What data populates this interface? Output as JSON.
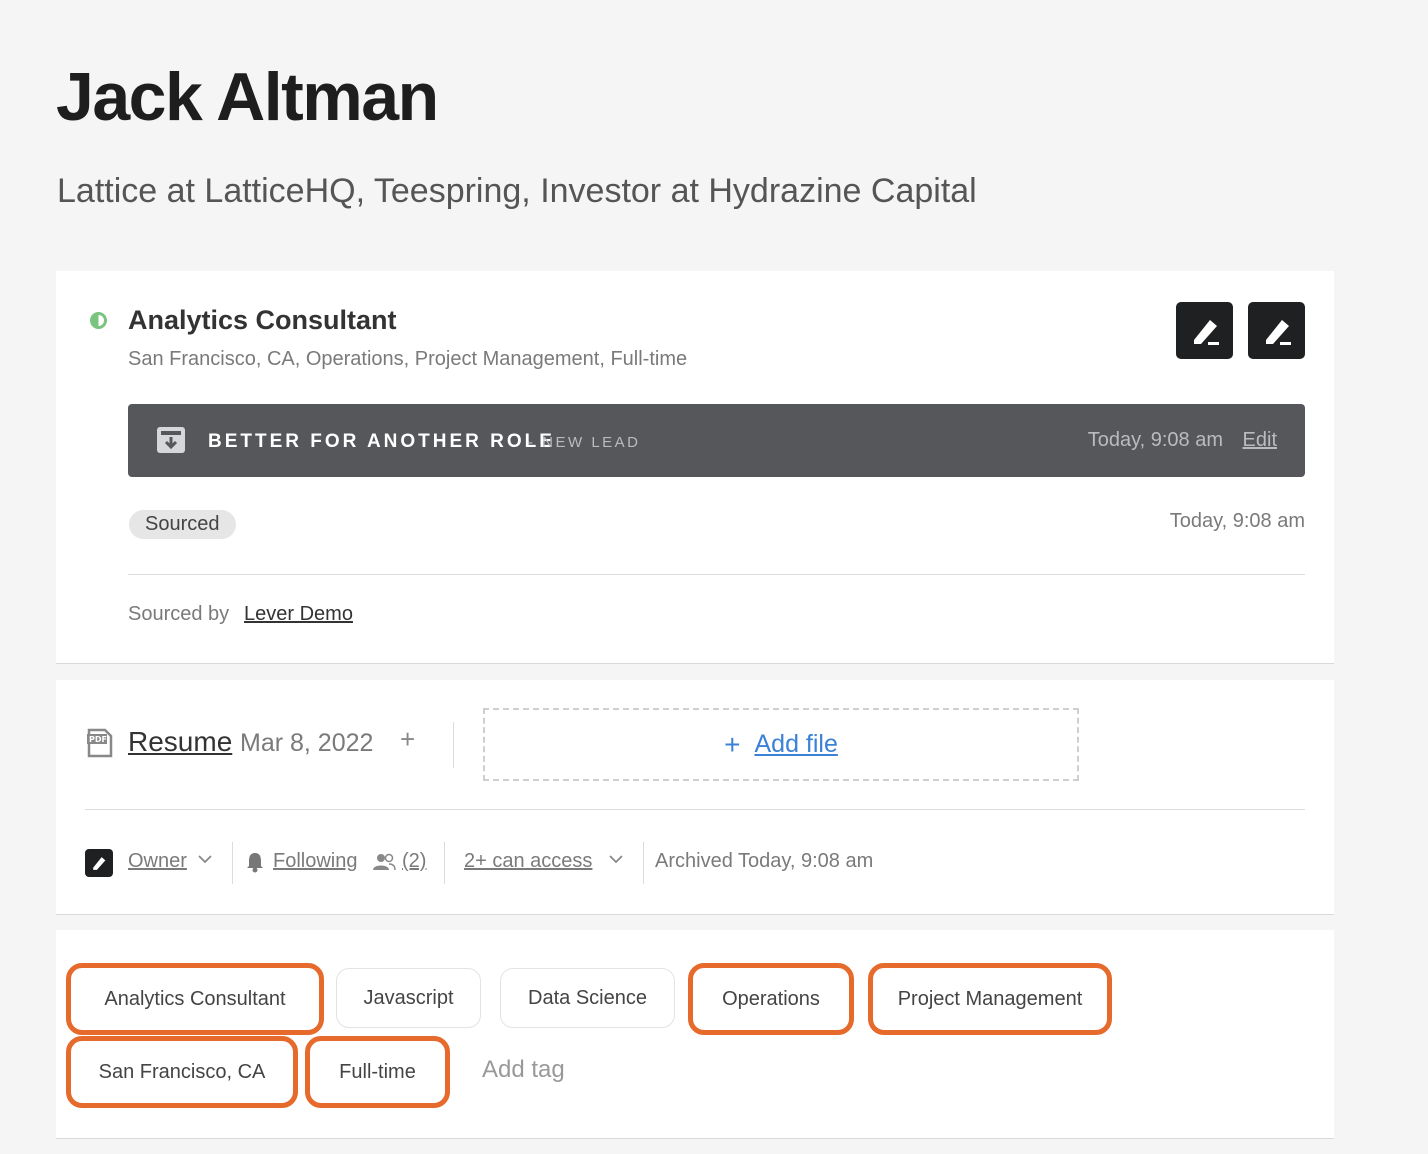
{
  "candidate": {
    "name": "Jack Altman",
    "headline": "Lattice at LatticeHQ, Teespring, Investor at Hydrazine Capital"
  },
  "opportunity": {
    "title": "Analytics Consultant",
    "subtitle": "San Francisco, CA, Operations, Project Management, Full-time",
    "archive": {
      "reason": "BETTER FOR ANOTHER ROLE",
      "stage": "- NEW LEAD",
      "time": "Today, 9:08 am",
      "edit_label": "Edit"
    },
    "source": {
      "pill": "Sourced",
      "time": "Today, 9:08 am",
      "sourced_by_label": "Sourced by",
      "sourced_by": "Lever Demo"
    }
  },
  "files": {
    "resume_label": "Resume",
    "resume_date": "Mar 8, 2022",
    "plus": "+",
    "add_file_plus": "+",
    "add_file_label": "Add file"
  },
  "meta": {
    "owner_label": "Owner",
    "following_label": "Following",
    "followers_count": "(2)",
    "access_label": "2+ can access",
    "archived_text": "Archived Today, 9:08 am"
  },
  "tags": {
    "items": [
      {
        "label": "Analytics Consultant",
        "highlighted": true
      },
      {
        "label": "Javascript",
        "highlighted": false
      },
      {
        "label": "Data Science",
        "highlighted": false
      },
      {
        "label": "Operations",
        "highlighted": true
      },
      {
        "label": "Project Management",
        "highlighted": true
      },
      {
        "label": "San Francisco, CA",
        "highlighted": true
      },
      {
        "label": "Full-time",
        "highlighted": true
      }
    ],
    "add_tag_label": "Add tag"
  },
  "colors": {
    "highlight": "#e56a2b",
    "archive_bar": "#55575b",
    "link_blue": "#3b82d6",
    "status_green": "#7bc47f"
  }
}
